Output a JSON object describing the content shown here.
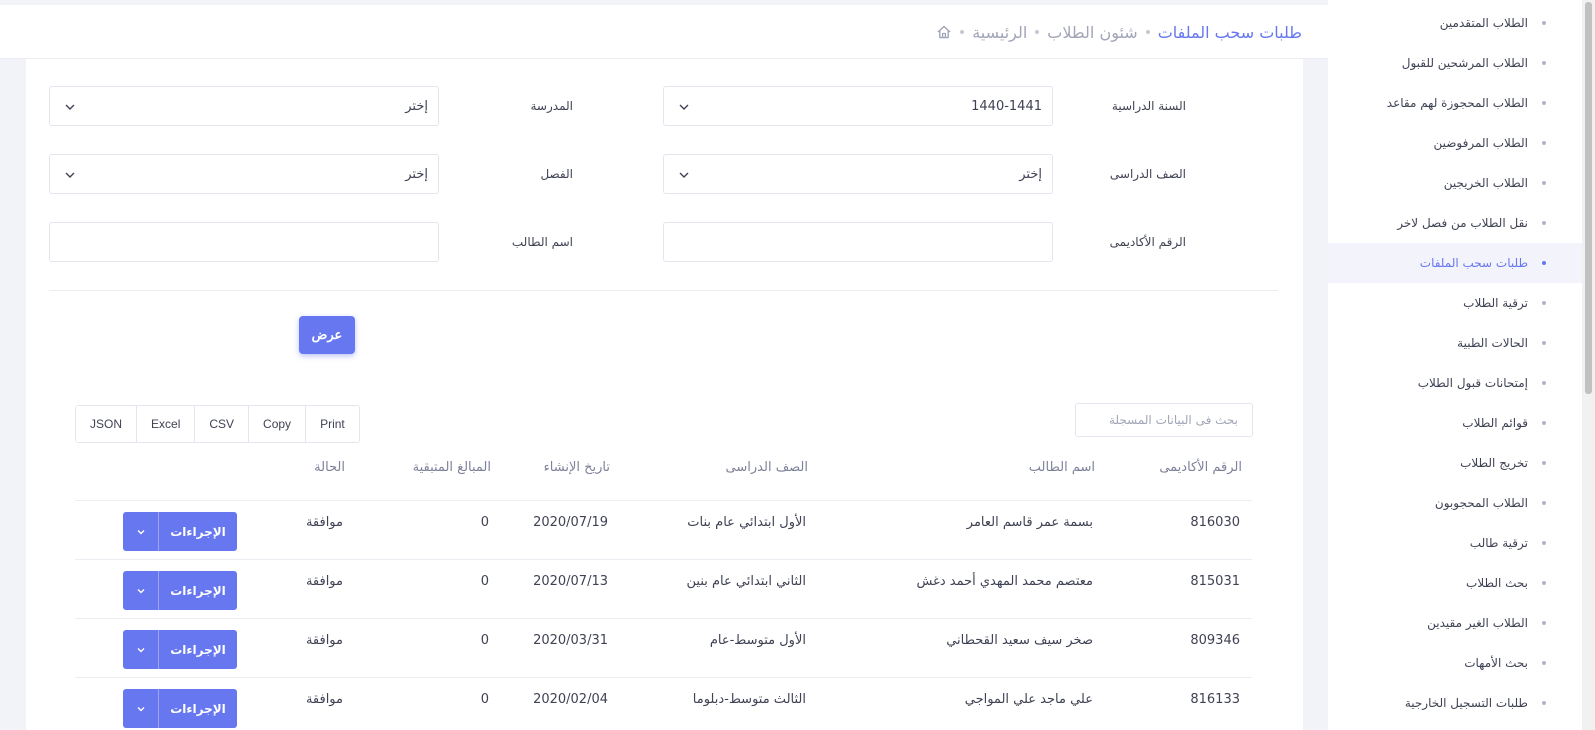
{
  "breadcrumb": {
    "home": "home-icon",
    "level1": "الرئيسية",
    "level2": "شئون الطلاب",
    "current": "طلبات سحب الملفات"
  },
  "sidebar": {
    "items": [
      {
        "label": "الطلاب المتقدمين"
      },
      {
        "label": "الطلاب المرشحين للقبول"
      },
      {
        "label": "الطلاب المحجوزة لهم مقاعد"
      },
      {
        "label": "الطلاب المرفوضين"
      },
      {
        "label": "الطلاب الخريجين"
      },
      {
        "label": "نقل الطلاب من فصل لاخر"
      },
      {
        "label": "طلبات سحب الملفات",
        "active": true
      },
      {
        "label": "ترقية الطلاب"
      },
      {
        "label": "الحالات الطبية"
      },
      {
        "label": "إمتحانات قبول الطلاب"
      },
      {
        "label": "قوائم الطلاب"
      },
      {
        "label": "تخريج الطلاب"
      },
      {
        "label": "الطلاب المحجوبون"
      },
      {
        "label": "ترقية طالب"
      },
      {
        "label": "بحث الطلاب"
      },
      {
        "label": "الطلاب الغير مقيدين"
      },
      {
        "label": "بحث الأمهات"
      },
      {
        "label": "طلبات التسجيل الخارجية"
      }
    ]
  },
  "filters": {
    "academic_year": {
      "label": "السنة الدراسية",
      "value": "1440-1441"
    },
    "school": {
      "label": "المدرسة",
      "value": "إختر"
    },
    "grade": {
      "label": "الصف الدراسى",
      "value": "إختر"
    },
    "class": {
      "label": "الفصل",
      "value": "إختر"
    },
    "academic_number": {
      "label": "الرقم الأكاديمى",
      "value": ""
    },
    "student_name": {
      "label": "اسم الطالب",
      "value": ""
    },
    "show_button": "عرض"
  },
  "table": {
    "search_placeholder": "بحث فى البيانات المسجلة",
    "export_buttons": [
      "JSON",
      "Excel",
      "CSV",
      "Copy",
      "Print"
    ],
    "headers": {
      "academic_number": "الرقم الأكاديمى",
      "student_name": "اسم الطالب",
      "grade": "الصف الدراسى",
      "created_date": "تاريخ الإنشاء",
      "remaining_amounts": "المبالغ المتبقية",
      "status": "الحالة"
    },
    "actions_label": "الإجراءات",
    "rows": [
      {
        "academic_number": "816030",
        "student_name": "بسمة عمر قاسم العامر",
        "grade": "الأول ابتدائي عام بنات",
        "created_date": "2020/07/19",
        "remaining_amounts": "0",
        "status": "موافقة"
      },
      {
        "academic_number": "815031",
        "student_name": "معتصم محمد المهدي أحمد دغش",
        "grade": "الثاني ابتدائي عام بنين",
        "created_date": "2020/07/13",
        "remaining_amounts": "0",
        "status": "موافقة"
      },
      {
        "academic_number": "809346",
        "student_name": "صخر سيف سعيد القحطاني",
        "grade": "الأول متوسط-عام",
        "created_date": "2020/03/31",
        "remaining_amounts": "0",
        "status": "موافقة"
      },
      {
        "academic_number": "816133",
        "student_name": "علي ماجد علي المواجي",
        "grade": "الثالث متوسط-دبلوما",
        "created_date": "2020/02/04",
        "remaining_amounts": "0",
        "status": "موافقة"
      }
    ]
  },
  "colors": {
    "accent": "#6777ef",
    "text": "#3f4254",
    "muted": "#a1a5b7",
    "background": "#f2f3f8"
  }
}
